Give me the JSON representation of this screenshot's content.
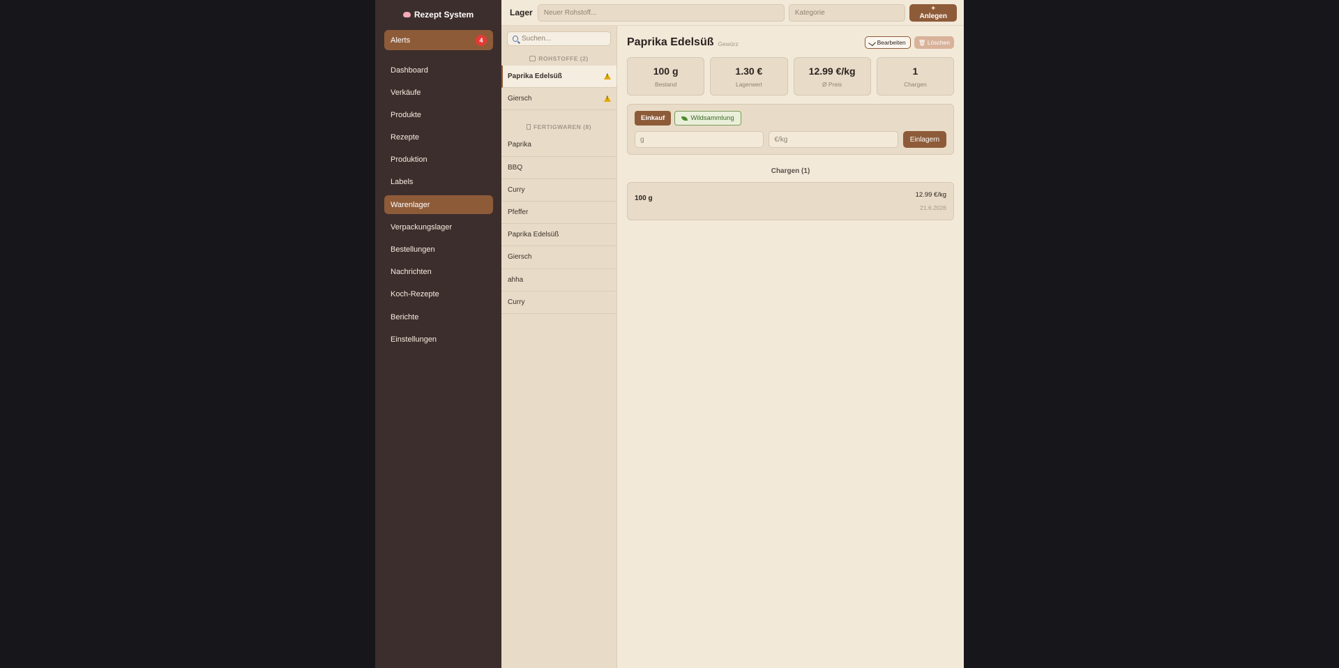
{
  "sidebar": {
    "brand": "Rezept System",
    "alerts": {
      "label": "Alerts",
      "count": "4"
    },
    "items": [
      {
        "label": "Dashboard"
      },
      {
        "label": "Verkäufe"
      },
      {
        "label": "Produkte"
      },
      {
        "label": "Rezepte"
      },
      {
        "label": "Produktion"
      },
      {
        "label": "Labels"
      },
      {
        "label": "Warenlager"
      },
      {
        "label": "Verpackungslager"
      },
      {
        "label": "Bestellungen"
      },
      {
        "label": "Nachrichten"
      },
      {
        "label": "Koch-Rezepte"
      },
      {
        "label": "Berichte"
      },
      {
        "label": "Einstellungen"
      }
    ],
    "active_item": "Warenlager"
  },
  "topbar": {
    "title": "Lager",
    "new_raw_placeholder": "Neuer Rohstoff...",
    "category_placeholder": "Kategorie",
    "create_label": "+ Anlegen"
  },
  "list": {
    "search_placeholder": "Suchen...",
    "raw_group": "ROHSTOFFE (2)",
    "raw_items": [
      {
        "label": "Paprika Edelsüß",
        "warning": true
      },
      {
        "label": "Giersch",
        "warning": true
      }
    ],
    "finished_group": "FERTIGWAREN (8)",
    "finished_items": [
      {
        "label": "Paprika"
      },
      {
        "label": "BBQ"
      },
      {
        "label": "Curry"
      },
      {
        "label": "Pfeffer"
      },
      {
        "label": "Paprika Edelsüß"
      },
      {
        "label": "Giersch"
      },
      {
        "label": "ahha"
      },
      {
        "label": "Curry"
      }
    ]
  },
  "detail": {
    "title": "Paprika Edelsüß",
    "subtitle": "Gewürz",
    "edit_label": "Bearbeiten",
    "delete_label": "Löschen",
    "stats": [
      {
        "value": "100 g",
        "label": "Bestand"
      },
      {
        "value": "1.30 €",
        "label": "Lagerwert"
      },
      {
        "value": "12.99 €/kg",
        "label": "Ø Preis"
      },
      {
        "value": "1",
        "label": "Chargen"
      }
    ],
    "modes": {
      "buy": "Einkauf",
      "wild": "Wildsammlung"
    },
    "amount_placeholder": "g",
    "price_placeholder": "€/kg",
    "store_label": "Einlagern",
    "batches_title": "Chargen (1)",
    "batches": [
      {
        "amount": "100 g",
        "price": "12.99 €/kg",
        "date": "21.6.2026"
      }
    ]
  },
  "colors": {
    "accent": "#8e5b39",
    "sidebar_bg": "#3c2e2c",
    "content_bg": "#f2e9d9",
    "badge": "#e53935"
  }
}
